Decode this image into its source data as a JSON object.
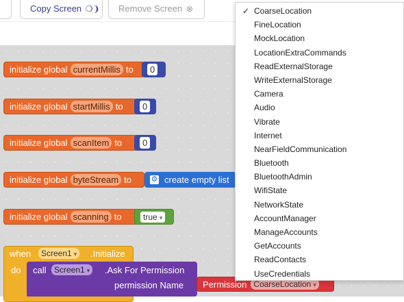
{
  "toolbar": {
    "copy_screen_label": "Copy Screen",
    "remove_screen_label": "Remove Screen"
  },
  "blocks": {
    "initialize_global": "initialize global",
    "to": "to",
    "g1": {
      "name": "currentMillis",
      "value": "0"
    },
    "g2": {
      "name": "startMillis",
      "value": "0"
    },
    "g3": {
      "name": "scanItem",
      "value": "0"
    },
    "g4": {
      "name": "byteStream",
      "value": "create empty list"
    },
    "g5": {
      "name": "scanning",
      "value": "true"
    },
    "when": "when",
    "screen_component": "Screen1",
    "initialize_event": ".Initialize",
    "do": "do",
    "call": "call",
    "ask_method": ".Ask For Permission",
    "permission_name_label": "permission Name",
    "permission_label": "Permission",
    "permission_value": "CoarseLocation"
  },
  "menu": {
    "selected": "CoarseLocation",
    "items": [
      "CoarseLocation",
      "FineLocation",
      "MockLocation",
      "LocationExtraCommands",
      "ReadExternalStorage",
      "WriteExternalStorage",
      "Camera",
      "Audio",
      "Vibrate",
      "Internet",
      "NearFieldCommunication",
      "Bluetooth",
      "BluetoothAdmin",
      "WifiState",
      "NetworkState",
      "AccountManager",
      "ManageAccounts",
      "GetAccounts",
      "ReadContacts",
      "UseCredentials"
    ]
  },
  "colors": {
    "variable_block": "#e8672a",
    "math_block": "#3a4aa8",
    "logic_block": "#5da33d",
    "list_block": "#2a6fd4",
    "event_block": "#f0b02a",
    "method_block": "#6b3aa6",
    "helper_block": "#d9363b"
  }
}
